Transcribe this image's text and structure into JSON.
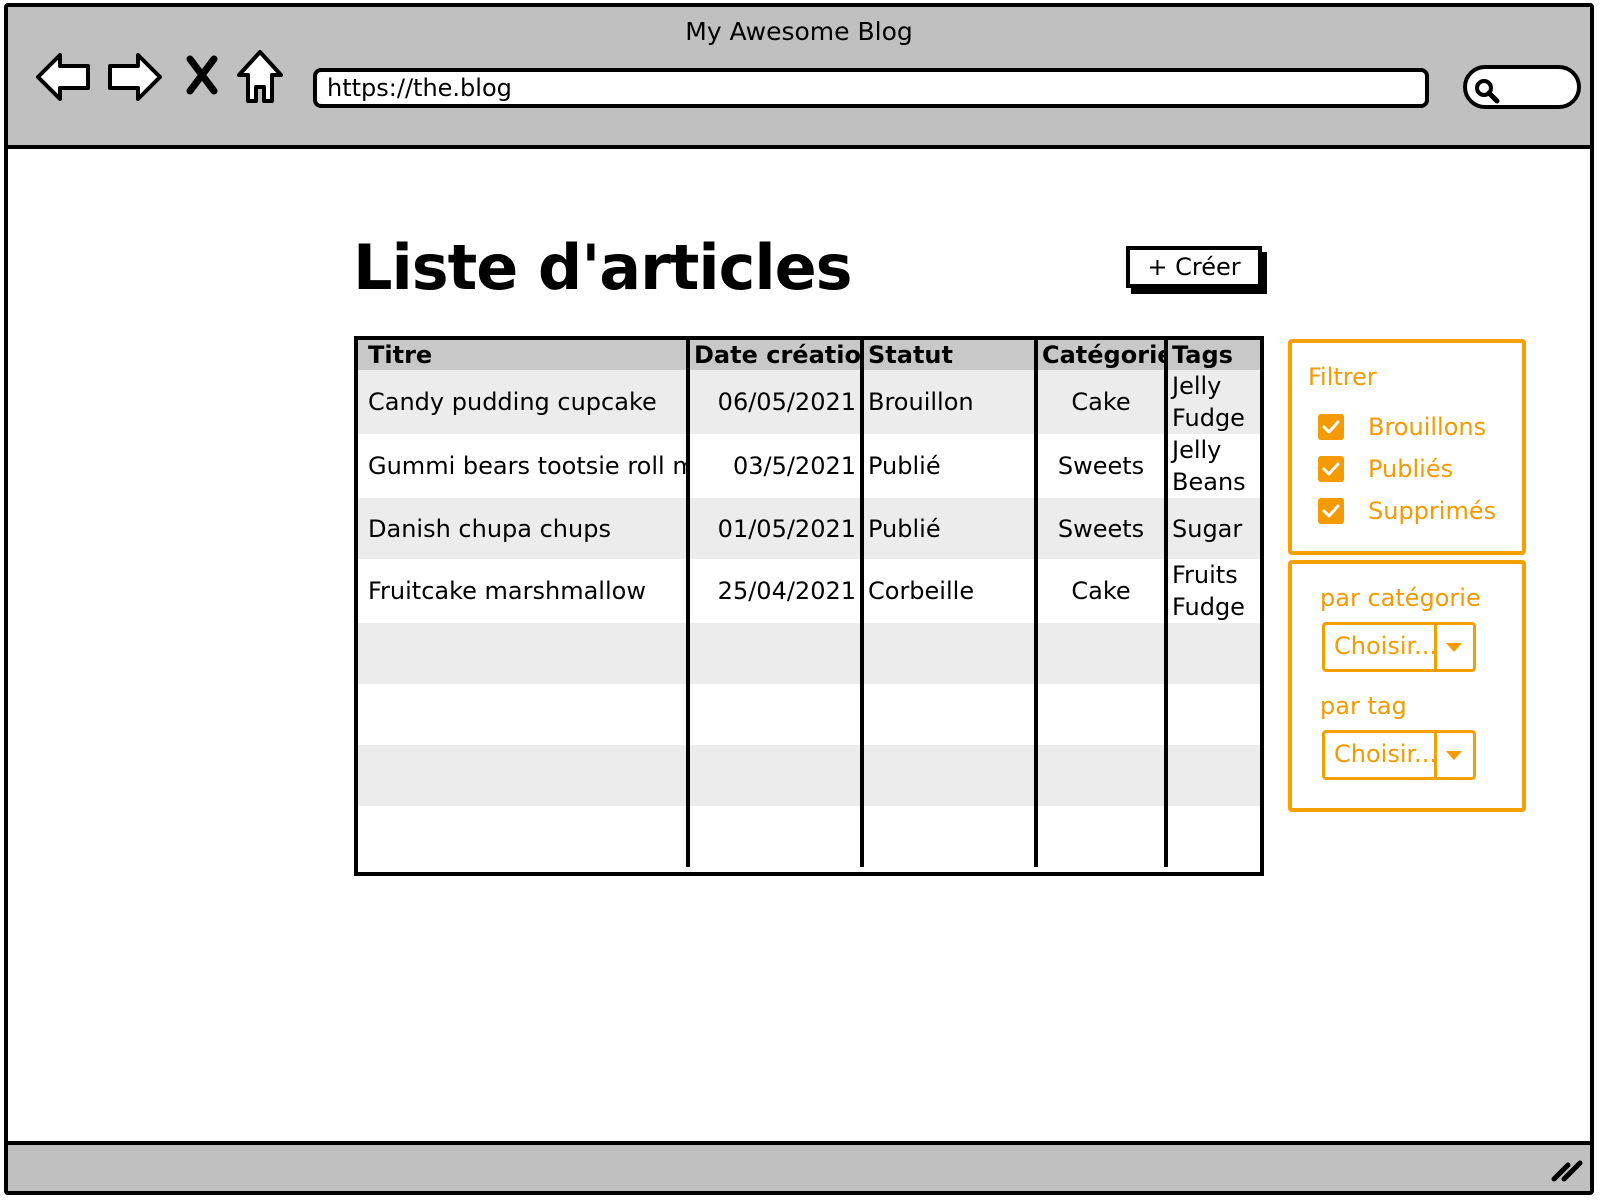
{
  "window": {
    "title": "My Awesome Blog"
  },
  "browser": {
    "url": "https://the.blog"
  },
  "page": {
    "title": "Liste d'articles",
    "create_label": "+ Créer"
  },
  "table": {
    "columns": [
      "Titre",
      "Date création",
      "Statut",
      "Catégorie",
      "Tags"
    ],
    "rows": [
      {
        "title": "Candy pudding cupcake",
        "date": "06/05/2021",
        "status": "Brouillon",
        "category": "Cake",
        "tags": [
          "Jelly",
          "Fudge"
        ]
      },
      {
        "title": "Gummi bears tootsie roll m",
        "date": "03/5/2021",
        "status": "Publié",
        "category": "Sweets",
        "tags": [
          "Jelly",
          "Beans"
        ]
      },
      {
        "title": "Danish chupa chups",
        "date": "01/05/2021",
        "status": "Publié",
        "category": "Sweets",
        "tags": [
          "Sugar"
        ]
      },
      {
        "title": "Fruitcake marshmallow",
        "date": "25/04/2021",
        "status": "Corbeille",
        "category": "Cake",
        "tags": [
          "Fruits",
          "Fudge"
        ]
      }
    ],
    "empty_rows": 4
  },
  "filters": {
    "title": "Filtrer",
    "status_options": [
      {
        "label": "Brouillons",
        "checked": true
      },
      {
        "label": "Publiés",
        "checked": true
      },
      {
        "label": "Supprimés",
        "checked": true
      }
    ],
    "category": {
      "label": "par catégorie",
      "value": "Choisir..."
    },
    "tag": {
      "label": "par tag",
      "value": "Choisir..."
    }
  },
  "colors": {
    "accent": "#f59a00",
    "chrome": "#c0c0c0",
    "row_alt": "#ececec",
    "header_row": "#c8c8c8"
  },
  "icons": [
    "back-icon",
    "forward-icon",
    "stop-icon",
    "home-icon",
    "search-icon",
    "checkbox-checked-icon",
    "dropdown-arrow-icon",
    "resize-grip-icon"
  ]
}
